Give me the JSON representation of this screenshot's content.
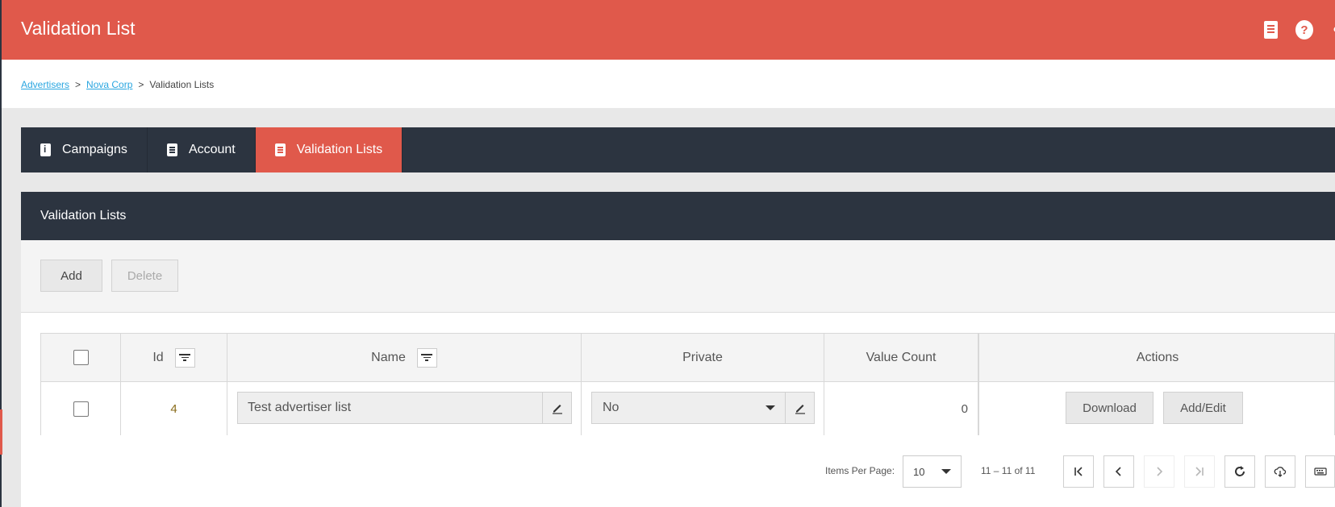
{
  "header": {
    "title": "Validation List"
  },
  "breadcrumb": {
    "items": [
      "Advertisers",
      "Nova Corp"
    ],
    "current": "Validation Lists",
    "separator": ">"
  },
  "tabs": [
    {
      "label": "Campaigns"
    },
    {
      "label": "Account"
    },
    {
      "label": "Validation Lists",
      "active": true
    }
  ],
  "panel": {
    "title": "Validation Lists"
  },
  "toolbar": {
    "add_label": "Add",
    "delete_label": "Delete"
  },
  "table": {
    "columns": [
      "Id",
      "Name",
      "Private",
      "Value Count",
      "Actions"
    ],
    "rows": [
      {
        "id": "4",
        "name": "Test advertiser list",
        "private": "No",
        "value_count": "0",
        "actions": [
          "Download",
          "Add/Edit"
        ]
      }
    ]
  },
  "pagination": {
    "items_per_page_label": "Items Per Page:",
    "items_per_page": "10",
    "range": "11 – 11 of 11"
  },
  "colors": {
    "accent": "#e0594b",
    "dark": "#2c3440",
    "link": "#2aa6e0"
  },
  "icons": [
    "document-icon",
    "help-icon",
    "user-icon",
    "info-icon",
    "list-icon",
    "filter-icon",
    "edit-icon",
    "chevron-down-icon",
    "first-page-icon",
    "prev-page-icon",
    "next-page-icon",
    "last-page-icon",
    "refresh-icon",
    "cloud-download-icon",
    "keyboard-icon"
  ]
}
